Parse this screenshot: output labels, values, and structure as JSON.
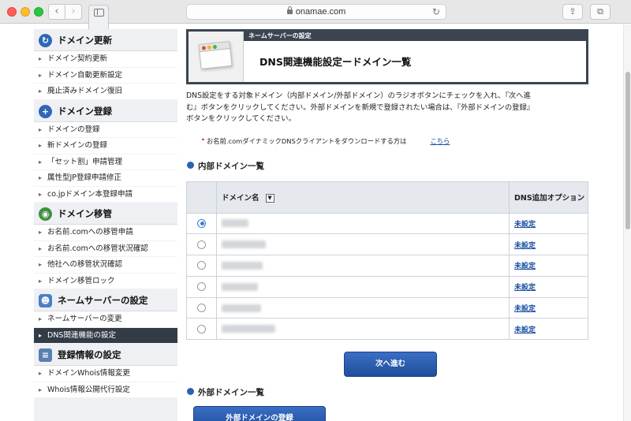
{
  "browser": {
    "url": "onamae.com"
  },
  "sidebar": {
    "sections": [
      {
        "title": "ドメイン更新",
        "icon": "refresh-icon",
        "items": [
          "ドメイン契約更新",
          "ドメイン自動更新設定",
          "廃止済みドメイン復旧"
        ]
      },
      {
        "title": "ドメイン登録",
        "icon": "plus-icon",
        "items": [
          "ドメインの登録",
          "新ドメインの登録",
          "「セット割」申請管理",
          "属性型JP登録申請修正",
          "co.jpドメイン本登録申請"
        ]
      },
      {
        "title": "ドメイン移管",
        "icon": "globe-icon",
        "items": [
          "お名前.comへの移管申請",
          "お名前.comへの移管状況確認",
          "他社への移管状況確認",
          "ドメイン移管ロック"
        ]
      },
      {
        "title": "ネームサーバーの設定",
        "icon": "user-icon",
        "items": [
          "ネームサーバーの変更",
          "DNS関連機能の設定"
        ]
      },
      {
        "title": "登録情報の設定",
        "icon": "document-icon",
        "items": [
          "ドメインWhois情報変更",
          "Whois情報公開代行設定"
        ]
      }
    ],
    "active_item": "DNS関連機能の設定"
  },
  "main": {
    "breadcrumb_band": "ネームサーバーの設定",
    "title": "DNS関連機能設定ードメイン一覧",
    "description": "DNS設定をする対象ドメイン（内部ドメイン/外部ドメイン）のラジオボタンにチェックを入れ、『次へ進む』ボタンをクリックしてください。外部ドメインを新規で登録されたい場合は、『外部ドメインの登録』ボタンをクリックしてください。",
    "note_text": "お名前.comダイナミックDNSクライアントをダウンロードする方は",
    "note_link": "こちら",
    "internal_heading": "内部ドメイン一覧",
    "table": {
      "col_domain": "ドメイン名",
      "col_option": "DNS追加オプション",
      "rows": [
        {
          "selected": true,
          "option": "未設定"
        },
        {
          "selected": false,
          "option": "未設定"
        },
        {
          "selected": false,
          "option": "未設定"
        },
        {
          "selected": false,
          "option": "未設定"
        },
        {
          "selected": false,
          "option": "未設定"
        },
        {
          "selected": false,
          "option": "未設定"
        }
      ]
    },
    "next_button": "次へ進む",
    "external_heading": "外部ドメイン一覧",
    "external_button": "外部ドメインの登録"
  }
}
